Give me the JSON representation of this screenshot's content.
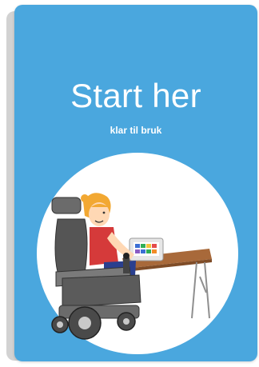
{
  "card": {
    "title": "Start her",
    "subtitle": "klar til bruk"
  },
  "colors": {
    "card_background": "#4aa7de",
    "circle_background": "#ffffff",
    "table_wood": "#a8693a",
    "chair_body": "#5b5b5b"
  },
  "illustration": {
    "icon": "person-in-wheelchair-with-communication-device-icon"
  }
}
